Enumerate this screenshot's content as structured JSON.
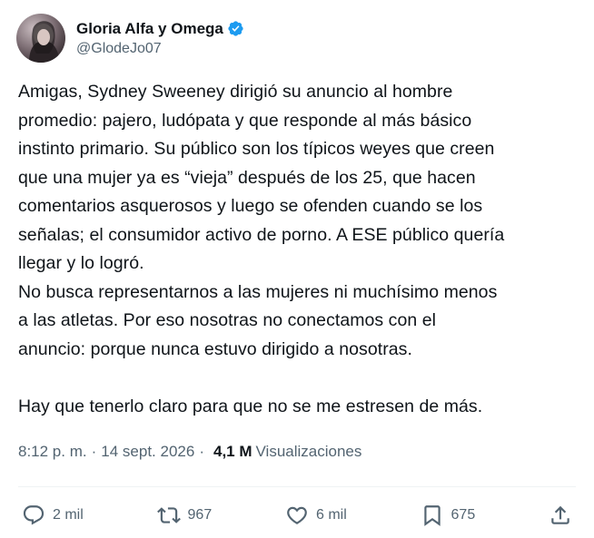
{
  "author": {
    "display_name": "Gloria Alfa y Omega",
    "handle": "@GlodeJo07",
    "verified": true
  },
  "tweet": {
    "text": "Amigas, Sydney Sweeney dirigió su anuncio al hombre\npromedio: pajero, ludópata y que responde al más básico\ninstinto primario. Su público son los típicos weyes que creen\nque una mujer ya es “vieja” después de los 25, que hacen\ncomentarios asquerosos y luego se ofenden cuando se los\nseñalas; el consumidor activo de porno. A ESE público quería\nllegar y lo logró.\nNo busca representarnos a las mujeres ni muchísimo menos\na las atletas. Por eso nosotras no conectamos con el\nanuncio: porque nunca estuvo dirigido a nosotras.\n\nHay que tenerlo claro para que no se me estresen de más.",
    "time": "8:12 p. m.",
    "date": "14 sept. 2026",
    "views_count": "4,1 M",
    "views_label": "Visualizaciones"
  },
  "actions": {
    "replies": "2 mil",
    "reposts": "967",
    "likes": "6 mil",
    "bookmarks": "675"
  },
  "icons": [
    "reply-icon",
    "repost-icon",
    "like-icon",
    "bookmark-icon",
    "share-icon",
    "verified-badge-icon"
  ],
  "colors": {
    "text": "#0f1419",
    "secondary": "#536471",
    "verified": "#1d9bf0"
  }
}
